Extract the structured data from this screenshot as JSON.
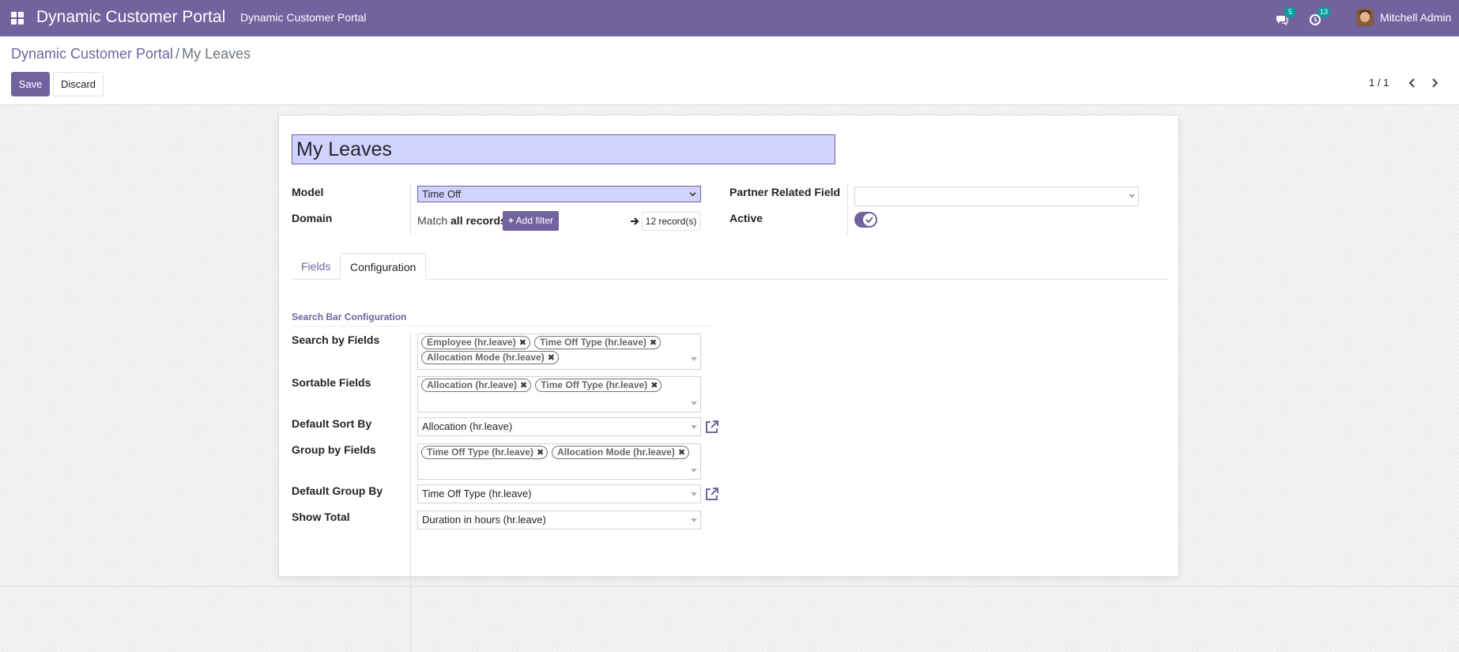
{
  "nav": {
    "brand": "Dynamic Customer Portal",
    "menu_item": "Dynamic Customer Portal",
    "messages_badge": "5",
    "activities_badge": "13",
    "user_name": "Mitchell Admin"
  },
  "breadcrumb": {
    "parent": "Dynamic Customer Portal",
    "separator": "/",
    "current": "My Leaves"
  },
  "actions": {
    "save": "Save",
    "discard": "Discard"
  },
  "pager": {
    "value": "1 / 1"
  },
  "form": {
    "name": "My Leaves",
    "model_label": "Model",
    "model_value": "Time Off",
    "domain_label": "Domain",
    "domain_match": "Match",
    "domain_all": "all records",
    "add_filter": "Add filter",
    "records": "12 record(s)",
    "partner_label": "Partner Related Field",
    "partner_value": "",
    "active_label": "Active",
    "active": true
  },
  "tabs": [
    "Fields",
    "Configuration"
  ],
  "config": {
    "section_title": "Search Bar Configuration",
    "search_label": "Search by Fields",
    "search_tags": [
      "Employee (hr.leave)",
      "Time Off Type (hr.leave)",
      "Allocation Mode (hr.leave)"
    ],
    "sortable_label": "Sortable Fields",
    "sortable_tags": [
      "Allocation (hr.leave)",
      "Time Off Type (hr.leave)"
    ],
    "default_sort_label": "Default Sort By",
    "default_sort_value": "Allocation (hr.leave)",
    "group_label": "Group by Fields",
    "group_tags": [
      "Time Off Type (hr.leave)",
      "Allocation Mode (hr.leave)"
    ],
    "default_group_label": "Default Group By",
    "default_group_value": "Time Off Type (hr.leave)",
    "show_total_label": "Show Total",
    "show_total_value": "Duration in hours (hr.leave)"
  },
  "colors": {
    "brand": "#71639e",
    "badge": "#00a09d",
    "highlight": "#d2d2ff"
  }
}
